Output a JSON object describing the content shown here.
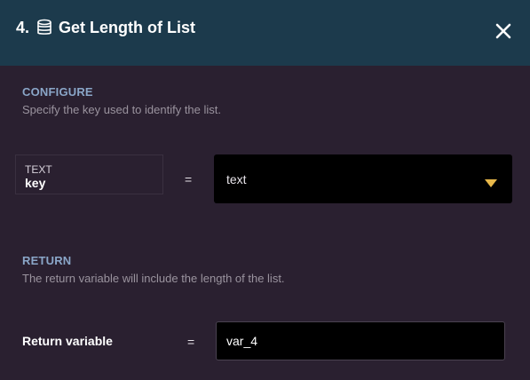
{
  "header": {
    "step": "4.",
    "icon": "database-icon",
    "title": "Get Length of List",
    "close_icon": "close-icon",
    "background": "#1c3a4c"
  },
  "configure": {
    "title": "CONFIGURE",
    "description": "Specify the key used to identify the list.",
    "key": {
      "type": "TEXT",
      "name": "key"
    },
    "equals": "=",
    "select": {
      "value": "text",
      "caret_color": "#e8b84a"
    }
  },
  "return": {
    "title": "RETURN",
    "description": "The return variable will include the length of the list.",
    "label": "Return variable",
    "equals": "=",
    "value": "var_4"
  }
}
